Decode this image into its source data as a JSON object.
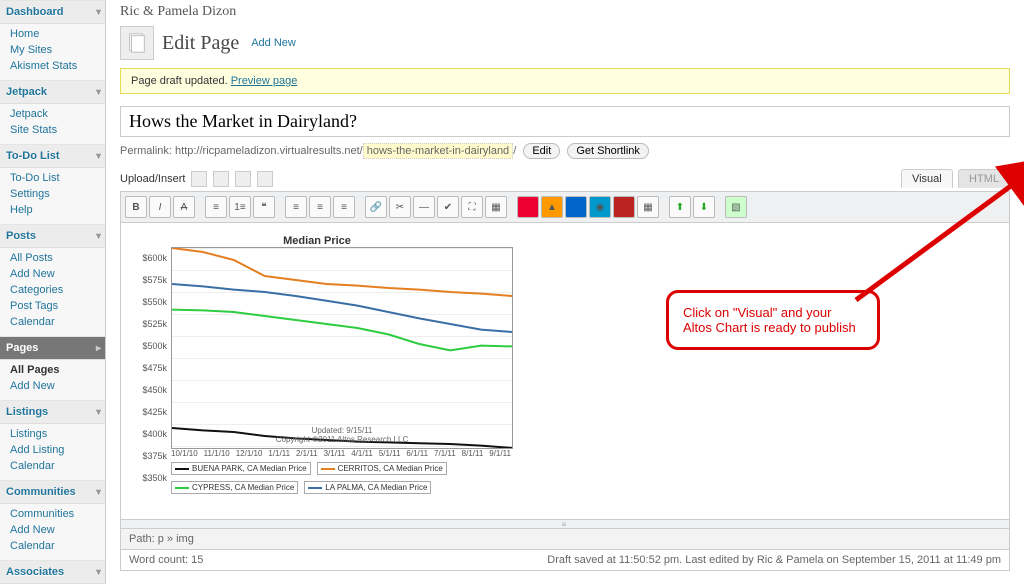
{
  "sidebar": {
    "groups": [
      {
        "label": "Dashboard",
        "active": false,
        "items": [
          "Home",
          "My Sites",
          "Akismet Stats"
        ]
      },
      {
        "label": "Jetpack",
        "active": false,
        "items": [
          "Jetpack",
          "Site Stats"
        ]
      },
      {
        "label": "To-Do List",
        "active": false,
        "items": [
          "To-Do List",
          "Settings",
          "Help"
        ]
      },
      {
        "label": "Posts",
        "active": false,
        "items": [
          "All Posts",
          "Add New",
          "Categories",
          "Post Tags",
          "Calendar"
        ]
      },
      {
        "label": "Pages",
        "active": true,
        "items_bold": 0,
        "items": [
          "All Pages",
          "Add New"
        ]
      },
      {
        "label": "Listings",
        "active": false,
        "items": [
          "Listings",
          "Add Listing",
          "Calendar"
        ]
      },
      {
        "label": "Communities",
        "active": false,
        "items": [
          "Communities",
          "Add New",
          "Calendar"
        ]
      },
      {
        "label": "Associates",
        "active": false,
        "items": []
      }
    ]
  },
  "header": {
    "site_title": "Ric & Pamela Dizon",
    "page_heading": "Edit Page",
    "add_new": "Add New"
  },
  "notice": {
    "text": "Page draft updated. ",
    "link": "Preview page"
  },
  "editor": {
    "title_value": "Hows the Market in Dairyland?",
    "permalink_label": "Permalink:",
    "permalink_base": "http://ricpameladizon.virtualresults.net/",
    "permalink_slug": "hows-the-market-in-dairyland",
    "edit_btn": "Edit",
    "shortlink_btn": "Get Shortlink",
    "upload_label": "Upload/Insert",
    "tabs": {
      "visual": "Visual",
      "html": "HTML"
    },
    "path": "Path: p » img",
    "word_count_label": "Word count: ",
    "word_count": "15",
    "autosave": "Draft saved at 11:50:52 pm. Last edited by Ric & Pamela on September 15, 2011 at 11:49 pm"
  },
  "annotation": {
    "text": "Click on \"Visual\" and your Altos Chart is ready to publish"
  },
  "chart_data": {
    "type": "line",
    "title": "Median Price",
    "ylabel": "",
    "xlabel": "",
    "ylim": [
      350,
      600
    ],
    "yticks": [
      "$600k",
      "$575k",
      "$550k",
      "$525k",
      "$500k",
      "$475k",
      "$450k",
      "$425k",
      "$400k",
      "$375k",
      "$350k"
    ],
    "categories": [
      "10/1/10",
      "11/1/10",
      "12/1/10",
      "1/1/11",
      "2/1/11",
      "3/1/11",
      "4/1/11",
      "5/1/11",
      "6/1/11",
      "7/1/11",
      "8/1/11",
      "9/1/11"
    ],
    "series": [
      {
        "name": "BUENA PARK, CA Median Price",
        "color": "#111111",
        "values": [
          375,
          372,
          370,
          365,
          362,
          360,
          358,
          357,
          356,
          355,
          353,
          350
        ]
      },
      {
        "name": "CERRITOS, CA Median Price",
        "color": "#e67e22",
        "values": [
          600,
          595,
          585,
          565,
          560,
          555,
          553,
          550,
          548,
          545,
          543,
          540
        ]
      },
      {
        "name": "CYPRESS, CA Median Price",
        "color": "#2ecc40",
        "values": [
          523,
          522,
          520,
          515,
          510,
          505,
          500,
          492,
          480,
          472,
          478,
          477
        ]
      },
      {
        "name": "LA PALMA, CA Median Price",
        "color": "#3b6ea5",
        "values": [
          555,
          552,
          548,
          545,
          540,
          534,
          528,
          520,
          512,
          505,
          498,
          495
        ]
      }
    ],
    "footer_lines": [
      "Updated: 9/15/11",
      "Copyright ©2011 Altos Research LLC"
    ]
  }
}
